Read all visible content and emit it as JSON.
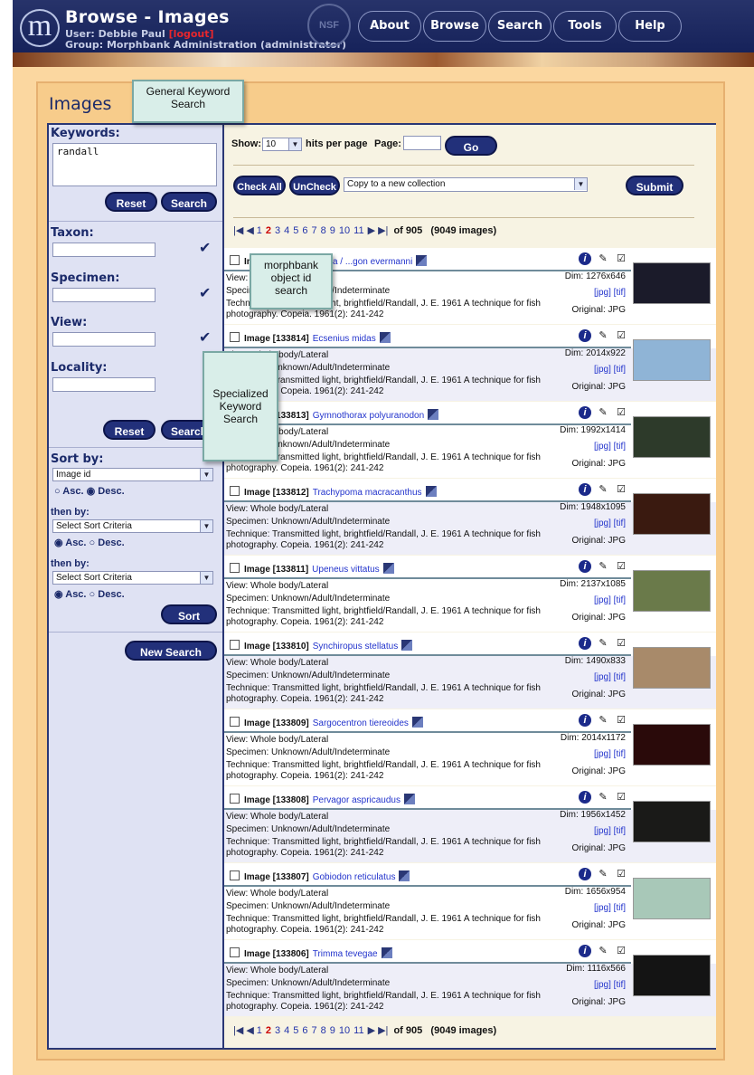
{
  "header": {
    "title": "Browse - Images",
    "user_label": "User: Debbie Paul",
    "logout": "[logout]",
    "group": "Group: Morphbank Administration (administrator)",
    "logo": "m",
    "seal": "NSF"
  },
  "nav": [
    {
      "label": "About"
    },
    {
      "label": "Browse"
    },
    {
      "label": "Search"
    },
    {
      "label": "Tools"
    },
    {
      "label": "Help"
    }
  ],
  "page_title": "Images",
  "sidebar": {
    "keywords_label": "Keywords:",
    "keywords_value": "randall",
    "reset": "Reset",
    "search": "Search",
    "taxon": "Taxon:",
    "specimen": "Specimen:",
    "view": "View:",
    "locality": "Locality:",
    "sort_by": "Sort by:",
    "sort1": "Image id",
    "asc": "Asc.",
    "desc": "Desc.",
    "then_by": "then by:",
    "sort2": "Select Sort Criteria",
    "sort3": "Select Sort Criteria",
    "sort_btn": "Sort",
    "new_search": "New Search"
  },
  "toolbar": {
    "show": "Show:",
    "show_value": "10",
    "hits": "hits per page",
    "page": "Page:",
    "go": "Go",
    "check_all": "Check All",
    "uncheck": "UnCheck",
    "collection": "Copy to a new collection",
    "submit": "Submit"
  },
  "pagination": {
    "pages": [
      "1",
      "2",
      "3",
      "4",
      "5",
      "6",
      "7",
      "8",
      "9",
      "10",
      "11"
    ],
    "current": "2",
    "of": "of 905",
    "count": "(9049 images)"
  },
  "records": [
    {
      "id": "",
      "name": "Image [133815] Eviota / ...gon evermanni",
      "dim": "Dim: 1276x646",
      "view": "View: Whole body/Lateral",
      "specimen": "Specimen: Unknown/Adult/Indeterminate",
      "thumb": "#1b1b2a"
    },
    {
      "id": "Image [133814]",
      "name": "Ecsenius midas",
      "dim": "Dim: 2014x922",
      "view": "View: Whole body/Lateral",
      "specimen": "Specimen: Unknown/Adult/Indeterminate",
      "thumb": "#8fb4d6"
    },
    {
      "id": "Image [133813]",
      "name": "Gymnothorax polyuranodon",
      "dim": "Dim: 1992x1414",
      "view": "View: Whole body/Lateral",
      "specimen": "Specimen: Unknown/Adult/Indeterminate",
      "thumb": "#2d3a2a"
    },
    {
      "id": "Image [133812]",
      "name": "Trachypoma macracanthus",
      "dim": "Dim: 1948x1095",
      "view": "View: Whole body/Lateral",
      "specimen": "Specimen: Unknown/Adult/Indeterminate",
      "thumb": "#3a1a10"
    },
    {
      "id": "Image [133811]",
      "name": "Upeneus vittatus",
      "dim": "Dim: 2137x1085",
      "view": "View: Whole body/Lateral",
      "specimen": "Specimen: Unknown/Adult/Indeterminate",
      "thumb": "#6a7a4a"
    },
    {
      "id": "Image [133810]",
      "name": "Synchiropus stellatus",
      "dim": "Dim: 1490x833",
      "view": "View: Whole body/Lateral",
      "specimen": "Specimen: Unknown/Adult/Indeterminate",
      "thumb": "#a88a6a"
    },
    {
      "id": "Image [133809]",
      "name": "Sargocentron tiereoides",
      "dim": "Dim: 2014x1172",
      "view": "View: Whole body/Lateral",
      "specimen": "Specimen: Unknown/Adult/Indeterminate",
      "thumb": "#2a0a0a"
    },
    {
      "id": "Image [133808]",
      "name": "Pervagor aspricaudus",
      "dim": "Dim: 1956x1452",
      "view": "View: Whole body/Lateral",
      "specimen": "Specimen: Unknown/Adult/Indeterminate",
      "thumb": "#1a1a18"
    },
    {
      "id": "Image [133807]",
      "name": "Gobiodon reticulatus",
      "dim": "Dim: 1656x954",
      "view": "View: Whole body/Lateral",
      "specimen": "Specimen: Unknown/Adult/Indeterminate",
      "thumb": "#a8c8b8"
    },
    {
      "id": "Image [133806]",
      "name": "Trimma tevegae",
      "dim": "Dim: 1116x566",
      "view": "View: Whole body/Lateral",
      "specimen": "Specimen: Unknown/Adult/Indeterminate",
      "thumb": "#141414"
    }
  ],
  "technique": "Technique: Transmitted light, brightfield/Randall, J. E. 1961 A technique for fish",
  "technique2": "photography. Copeia. 1961(2): 241-242",
  "links": "[jpg]  [tif]",
  "original": "Original: JPG",
  "callouts": {
    "general": "General Keyword Search",
    "objid": "morphbank object id search",
    "special": "Specialized Keyword Search"
  }
}
